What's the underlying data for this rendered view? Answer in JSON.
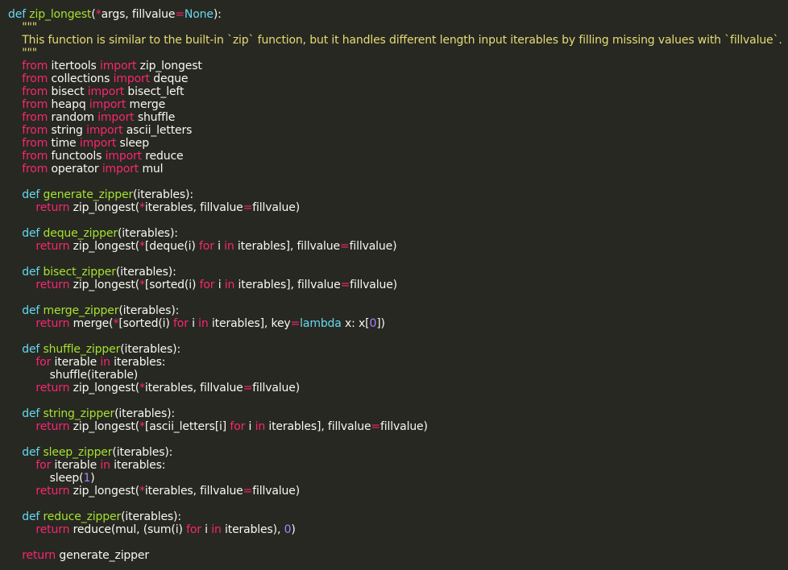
{
  "editor": {
    "language": "python",
    "theme": "monokai",
    "colors": {
      "background": "#272822",
      "text": "#f8f8f2",
      "keyword": "#f92672",
      "def": "#66d9ef",
      "function": "#a6e22e",
      "string": "#e6db74",
      "number": "#ae81ff"
    },
    "lines": [
      [
        [
          "def",
          "def"
        ],
        [
          "text",
          " "
        ],
        [
          "fn",
          "zip_longest"
        ],
        [
          "text",
          "("
        ],
        [
          "kw",
          "*"
        ],
        [
          "text",
          "args, fillvalue"
        ],
        [
          "kw",
          "="
        ],
        [
          "def",
          "None"
        ],
        [
          "text",
          "):"
        ]
      ],
      [
        [
          "str",
          "    \"\"\""
        ]
      ],
      [
        [
          "str",
          "    This function is similar to the built-in `zip` function, but it handles different length input iterables by filling missing values with `fillvalue`."
        ]
      ],
      [
        [
          "str",
          "    \"\"\""
        ]
      ],
      [
        [
          "text",
          "    "
        ],
        [
          "kw",
          "from"
        ],
        [
          "text",
          " itertools "
        ],
        [
          "kw",
          "import"
        ],
        [
          "text",
          " zip_longest"
        ]
      ],
      [
        [
          "text",
          "    "
        ],
        [
          "kw",
          "from"
        ],
        [
          "text",
          " collections "
        ],
        [
          "kw",
          "import"
        ],
        [
          "text",
          " deque"
        ]
      ],
      [
        [
          "text",
          "    "
        ],
        [
          "kw",
          "from"
        ],
        [
          "text",
          " bisect "
        ],
        [
          "kw",
          "import"
        ],
        [
          "text",
          " bisect_left"
        ]
      ],
      [
        [
          "text",
          "    "
        ],
        [
          "kw",
          "from"
        ],
        [
          "text",
          " heapq "
        ],
        [
          "kw",
          "import"
        ],
        [
          "text",
          " merge"
        ]
      ],
      [
        [
          "text",
          "    "
        ],
        [
          "kw",
          "from"
        ],
        [
          "text",
          " random "
        ],
        [
          "kw",
          "import"
        ],
        [
          "text",
          " shuffle"
        ]
      ],
      [
        [
          "text",
          "    "
        ],
        [
          "kw",
          "from"
        ],
        [
          "text",
          " string "
        ],
        [
          "kw",
          "import"
        ],
        [
          "text",
          " ascii_letters"
        ]
      ],
      [
        [
          "text",
          "    "
        ],
        [
          "kw",
          "from"
        ],
        [
          "text",
          " time "
        ],
        [
          "kw",
          "import"
        ],
        [
          "text",
          " sleep"
        ]
      ],
      [
        [
          "text",
          "    "
        ],
        [
          "kw",
          "from"
        ],
        [
          "text",
          " functools "
        ],
        [
          "kw",
          "import"
        ],
        [
          "text",
          " reduce"
        ]
      ],
      [
        [
          "text",
          "    "
        ],
        [
          "kw",
          "from"
        ],
        [
          "text",
          " operator "
        ],
        [
          "kw",
          "import"
        ],
        [
          "text",
          " mul"
        ]
      ],
      [],
      [
        [
          "text",
          "    "
        ],
        [
          "def",
          "def"
        ],
        [
          "text",
          " "
        ],
        [
          "fn",
          "generate_zipper"
        ],
        [
          "text",
          "(iterables):"
        ]
      ],
      [
        [
          "text",
          "        "
        ],
        [
          "kw",
          "return"
        ],
        [
          "text",
          " zip_longest("
        ],
        [
          "kw",
          "*"
        ],
        [
          "text",
          "iterables, fillvalue"
        ],
        [
          "kw",
          "="
        ],
        [
          "text",
          "fillvalue)"
        ]
      ],
      [],
      [
        [
          "text",
          "    "
        ],
        [
          "def",
          "def"
        ],
        [
          "text",
          " "
        ],
        [
          "fn",
          "deque_zipper"
        ],
        [
          "text",
          "(iterables):"
        ]
      ],
      [
        [
          "text",
          "        "
        ],
        [
          "kw",
          "return"
        ],
        [
          "text",
          " zip_longest("
        ],
        [
          "kw",
          "*"
        ],
        [
          "text",
          "[deque(i) "
        ],
        [
          "kw",
          "for"
        ],
        [
          "text",
          " i "
        ],
        [
          "kw",
          "in"
        ],
        [
          "text",
          " iterables], fillvalue"
        ],
        [
          "kw",
          "="
        ],
        [
          "text",
          "fillvalue)"
        ]
      ],
      [],
      [
        [
          "text",
          "    "
        ],
        [
          "def",
          "def"
        ],
        [
          "text",
          " "
        ],
        [
          "fn",
          "bisect_zipper"
        ],
        [
          "text",
          "(iterables):"
        ]
      ],
      [
        [
          "text",
          "        "
        ],
        [
          "kw",
          "return"
        ],
        [
          "text",
          " zip_longest("
        ],
        [
          "kw",
          "*"
        ],
        [
          "text",
          "[sorted(i) "
        ],
        [
          "kw",
          "for"
        ],
        [
          "text",
          " i "
        ],
        [
          "kw",
          "in"
        ],
        [
          "text",
          " iterables], fillvalue"
        ],
        [
          "kw",
          "="
        ],
        [
          "text",
          "fillvalue)"
        ]
      ],
      [],
      [
        [
          "text",
          "    "
        ],
        [
          "def",
          "def"
        ],
        [
          "text",
          " "
        ],
        [
          "fn",
          "merge_zipper"
        ],
        [
          "text",
          "(iterables):"
        ]
      ],
      [
        [
          "text",
          "        "
        ],
        [
          "kw",
          "return"
        ],
        [
          "text",
          " merge("
        ],
        [
          "kw",
          "*"
        ],
        [
          "text",
          "[sorted(i) "
        ],
        [
          "kw",
          "for"
        ],
        [
          "text",
          " i "
        ],
        [
          "kw",
          "in"
        ],
        [
          "text",
          " iterables], key"
        ],
        [
          "kw",
          "="
        ],
        [
          "def",
          "lambda"
        ],
        [
          "text",
          " x: x["
        ],
        [
          "num",
          "0"
        ],
        [
          "text",
          "])"
        ]
      ],
      [],
      [
        [
          "text",
          "    "
        ],
        [
          "def",
          "def"
        ],
        [
          "text",
          " "
        ],
        [
          "fn",
          "shuffle_zipper"
        ],
        [
          "text",
          "(iterables):"
        ]
      ],
      [
        [
          "text",
          "        "
        ],
        [
          "kw",
          "for"
        ],
        [
          "text",
          " iterable "
        ],
        [
          "kw",
          "in"
        ],
        [
          "text",
          " iterables:"
        ]
      ],
      [
        [
          "text",
          "            shuffle(iterable)"
        ]
      ],
      [
        [
          "text",
          "        "
        ],
        [
          "kw",
          "return"
        ],
        [
          "text",
          " zip_longest("
        ],
        [
          "kw",
          "*"
        ],
        [
          "text",
          "iterables, fillvalue"
        ],
        [
          "kw",
          "="
        ],
        [
          "text",
          "fillvalue)"
        ]
      ],
      [],
      [
        [
          "text",
          "    "
        ],
        [
          "def",
          "def"
        ],
        [
          "text",
          " "
        ],
        [
          "fn",
          "string_zipper"
        ],
        [
          "text",
          "(iterables):"
        ]
      ],
      [
        [
          "text",
          "        "
        ],
        [
          "kw",
          "return"
        ],
        [
          "text",
          " zip_longest("
        ],
        [
          "kw",
          "*"
        ],
        [
          "text",
          "[ascii_letters[i] "
        ],
        [
          "kw",
          "for"
        ],
        [
          "text",
          " i "
        ],
        [
          "kw",
          "in"
        ],
        [
          "text",
          " iterables], fillvalue"
        ],
        [
          "kw",
          "="
        ],
        [
          "text",
          "fillvalue)"
        ]
      ],
      [],
      [
        [
          "text",
          "    "
        ],
        [
          "def",
          "def"
        ],
        [
          "text",
          " "
        ],
        [
          "fn",
          "sleep_zipper"
        ],
        [
          "text",
          "(iterables):"
        ]
      ],
      [
        [
          "text",
          "        "
        ],
        [
          "kw",
          "for"
        ],
        [
          "text",
          " iterable "
        ],
        [
          "kw",
          "in"
        ],
        [
          "text",
          " iterables:"
        ]
      ],
      [
        [
          "text",
          "            sleep("
        ],
        [
          "num",
          "1"
        ],
        [
          "text",
          ")"
        ]
      ],
      [
        [
          "text",
          "        "
        ],
        [
          "kw",
          "return"
        ],
        [
          "text",
          " zip_longest("
        ],
        [
          "kw",
          "*"
        ],
        [
          "text",
          "iterables, fillvalue"
        ],
        [
          "kw",
          "="
        ],
        [
          "text",
          "fillvalue)"
        ]
      ],
      [],
      [
        [
          "text",
          "    "
        ],
        [
          "def",
          "def"
        ],
        [
          "text",
          " "
        ],
        [
          "fn",
          "reduce_zipper"
        ],
        [
          "text",
          "(iterables):"
        ]
      ],
      [
        [
          "text",
          "        "
        ],
        [
          "kw",
          "return"
        ],
        [
          "text",
          " reduce(mul, (sum(i) "
        ],
        [
          "kw",
          "for"
        ],
        [
          "text",
          " i "
        ],
        [
          "kw",
          "in"
        ],
        [
          "text",
          " iterables), "
        ],
        [
          "num",
          "0"
        ],
        [
          "text",
          ")"
        ]
      ],
      [],
      [
        [
          "text",
          "    "
        ],
        [
          "kw",
          "return"
        ],
        [
          "text",
          " generate_zipper"
        ]
      ]
    ]
  }
}
